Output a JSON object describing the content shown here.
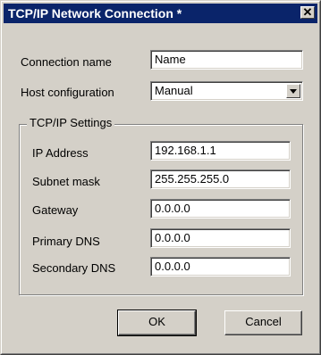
{
  "window": {
    "title": "TCP/IP Network Connection *",
    "close_glyph": "✕"
  },
  "connection_name": {
    "label": "Connection name",
    "value": "Name"
  },
  "host_configuration": {
    "label": "Host configuration",
    "selected": "Manual"
  },
  "tcpip_settings": {
    "legend": "TCP/IP Settings",
    "fields": [
      {
        "label": "IP Address",
        "value": "192.168.1.1"
      },
      {
        "label": "Subnet mask",
        "value": "255.255.255.0"
      },
      {
        "label": "Gateway",
        "value": "0.0.0.0"
      },
      {
        "label": "Primary DNS",
        "value": "0.0.0.0"
      },
      {
        "label": "Secondary DNS",
        "value": "0.0.0.0"
      }
    ]
  },
  "buttons": {
    "ok": "OK",
    "cancel": "Cancel"
  },
  "icons": {
    "close": "close-icon",
    "dropdown": "chevron-down-icon"
  },
  "colors": {
    "titlebar": "#0a246a",
    "face": "#d4d0c8"
  }
}
